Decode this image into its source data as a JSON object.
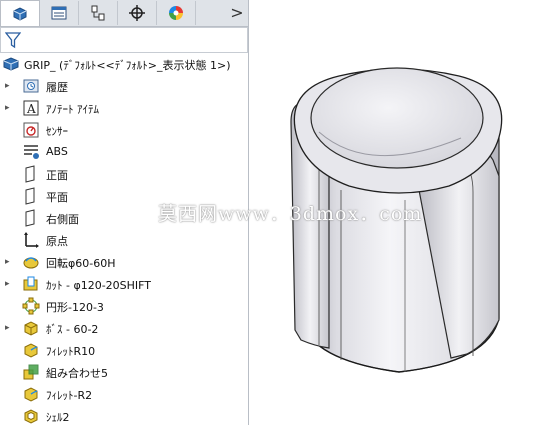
{
  "tabs": [
    {
      "name": "feature-manager",
      "icon": "feature-tree-icon"
    },
    {
      "name": "property-manager",
      "icon": "property-list-icon"
    },
    {
      "name": "configuration-manager",
      "icon": "configuration-icon"
    },
    {
      "name": "dimxpert",
      "icon": "crosshair-icon"
    },
    {
      "name": "display-manager",
      "icon": "color-wheel-icon"
    }
  ],
  "tab_more": ">",
  "root": {
    "label": "GRIP_ (ﾃﾞﾌｫﾙﾄ<<ﾃﾞﾌｫﾙﾄ>_表示状態 1>)"
  },
  "tree": [
    {
      "label": "履歴",
      "icon": "history-icon",
      "expandable": true
    },
    {
      "label": "ｱﾉﾃｰﾄ ｱｲﾃﾑ",
      "icon": "annotation-icon",
      "expandable": true
    },
    {
      "label": "ｾﾝｻｰ",
      "icon": "sensor-icon",
      "expandable": false
    },
    {
      "label": "ABS",
      "icon": "material-icon",
      "expandable": false
    },
    {
      "label": "正面",
      "icon": "plane-icon",
      "expandable": false
    },
    {
      "label": "平面",
      "icon": "plane-icon",
      "expandable": false
    },
    {
      "label": "右側面",
      "icon": "plane-icon",
      "expandable": false
    },
    {
      "label": "原点",
      "icon": "origin-icon",
      "expandable": false
    },
    {
      "label": "回転φ60-60H",
      "icon": "revolve-icon",
      "expandable": true
    },
    {
      "label": "ｶｯﾄ - φ120-20SHIFT",
      "icon": "cut-extrude-icon",
      "expandable": true
    },
    {
      "label": "円形-120-3",
      "icon": "circular-pattern-icon",
      "expandable": false
    },
    {
      "label": "ﾎﾞｽ - 60-2",
      "icon": "boss-extrude-icon",
      "expandable": true
    },
    {
      "label": "ﾌｨﾚｯﾄR10",
      "icon": "fillet-icon",
      "expandable": false
    },
    {
      "label": "組み合わせ5",
      "icon": "combine-icon",
      "expandable": false
    },
    {
      "label": "ﾌｨﾚｯﾄ-R2",
      "icon": "fillet-icon",
      "expandable": false
    },
    {
      "label": "ｼｪﾙ2",
      "icon": "shell-icon",
      "expandable": false
    }
  ],
  "watermark": "莫西网www．3dmox．com",
  "colors": {
    "accent": "#2f6fb5",
    "feature_yellow": "#e8c83a",
    "panel_bg": "#ffffff",
    "tab_bg": "#dfe3e8"
  }
}
